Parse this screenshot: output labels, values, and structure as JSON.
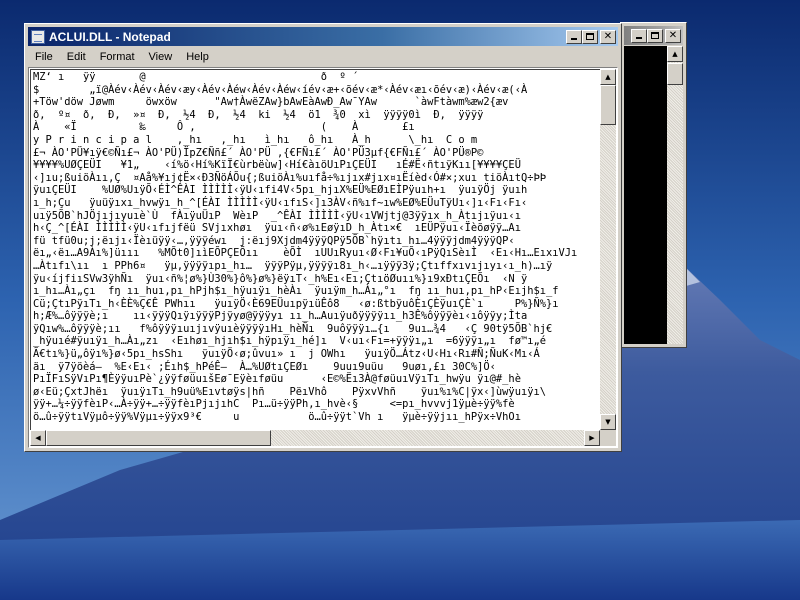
{
  "colors": {
    "active_title_start": "#0a246a",
    "active_title_end": "#a6caf0",
    "inactive_title": "#808080",
    "chrome": "#d4d0c8",
    "editor_bg": "#ffffff",
    "background_window_client": "#000000"
  },
  "background_window": {
    "title": "",
    "buttons": {
      "minimize_icon": "minimize-icon",
      "maximize_icon": "maximize-icon",
      "close_glyph": "✕"
    }
  },
  "notepad": {
    "title": "ACLUI.DLL - Notepad",
    "icon": "notepad-icon",
    "buttons": {
      "minimize_icon": "minimize-icon",
      "maximize_icon": "maximize-icon",
      "close_glyph": "✕"
    },
    "menu": [
      {
        "label": "File"
      },
      {
        "label": "Edit"
      },
      {
        "label": "Format"
      },
      {
        "label": "View"
      },
      {
        "label": "Help"
      }
    ],
    "lines": [
      "MZ‘ ı   ÿÿ       @                            ð  º ´ ",
      "$        „ï@Àév‹Àév‹Àév‹æy‹Àév‹Àéw‹Àév‹Àéw‹íév‹æ+‹õév‹æ*‹Àév‹æı‹õév‹æ)‹Àév‹æ(‹À",
      "+Töw'döw Jøwm     öwxöw      \"Aw†ÀwëZAw}bAwEàAwÐ_Aw¯YAw      `àwFtàwm%æw2{æv",
      "ð‚  º¤  ð‚  Ð‚  »¤  Ð‚  ½4  Ð‚  ½4  ki  ½4  ö1  ¾0  xì  ÿÿÿÿ0ì  Ð‚  ÿÿÿÿ",
      "À    «Ï          ‰     Ô ‚                    (    À       £ı",
      "y P r i n c i p a l    ‚_hı   ‚_hı   ì_hı   ô_hı   À_h      \\_hı  C o m",
      "£¬ ÀO'PÜ¥ıÿ€©Ñı£¬ ÀO'PÜ)ÏpZ€Ññ£´ ÀO'PÜ ‚{€FÑı£´ ÀO'PÜ3µf{€FÑı£´ ÀO'PÜ®P©",
      "¥¥¥¥%UØÇEÜI   ¥1„    ‹í%ö‹Hí%KïÏ€ùrbëùw]‹Hí€àıöUıPıÇEÜI   ıÉ#Ë‹ñtıÿKıı[¥¥¥¥ÇEÜ",
      "‹]ıu;ßuiöÀıı,Ç  ¤Aå%¥ıj¢Ë×‹Ð3ÑöÁÕu{;ßuiöÀı%uıfå÷%ıjıx#jıx¤ıËíèd‹Ó#×;xuı tiöÀıtQ÷ÞÞ",
      "ÿuıÇEÜI    %UØ%UıÿÕ‹ÉÌ^ÊÀI ÌÌÌÌÌ‹ÿU‹ıfi4V‹5pı_hjıX%EÜ%EØıEÌPÿuıh+ı  ÿuıÿÖj ÿuıh",
      "ı_h;Çu   ÿuüÿıxı_hvwÿı_h_^[ÉÀI ÌÌÌÌÌ‹ÿU‹ıfıS‹]ı3ÀV‹ñ%ıf~ıw%EØ%EÜuTÿUı‹]ı‹Fı‹Fı‹",
      "uıÿ5ÕB`hJÖjıjıyuıè`Ù  fÀıÿuÜıP  WèıP  _^ÊÀI ÌÌÌÌÌ‹ÿU‹ıVWjtj@3ÿÿıx_h_Àtıjıÿuı‹ı",
      "h‹Ç_^[ÉÀI ÌÌÌÌÌ‹ÿU‹ıfıjfëü SVjıxhøı  ÿuı‹ñ‹ø%ıEøÿıD_h_Àtı×€  ıEÜPÿuı‹Ïèõøÿÿ…Aı",
      "fü tfü0u;j;ëıjı‹Ïèıüÿÿ‹…,ÿÿÿéwı  j:ëıj9Xjdm4ÿÿÿQPÿ5ÕB`hÿıtı_hı…4ÿÿÿjdm4ÿÿÿQP‹",
      "ëı„‹ëı…A9Àı%]üııı   %MÕt0]ıìEÕPÇEÕıı    èÕÌ  ıUUıRyuı‹Ø‹Fı¥uÕ‹ıPÿQıSèıÌ  ‹Eı‹Hı…EıxıVJı",
      "…Àtıfı\\ıı  ı PPh6¤   ÿµ,ÿÿÿÿıpı_hı…  ÿÿÿPÿµ,ÿÿÿÿı8ı_h‹…ıÿÿÿ3ÿ;Çtıffxıvıjıyı‹ı_h)…ıÿ",
      "ÿu‹íjfiıSVw3ÿhÑı  ÿuı‹ñ%¦ø%}Ù30%}ô%}ø%}ëÿıT‹_h%Eı‹Eı;ÇtıöØuıı%}ı9xÐtıÇEÕı  ‹N ÿ",
      "ı_hı…Àı„çı  fŋ ıı_huı‚pı_hPjh$ı_hÿuıÿı_hèÀı  ÿuıÿm_h…Àı„°ı  fŋ ıı_huı‚pı_hP‹Eıjh$ı_f",
      "Cü;ÇtıPÿıTı_h‹ÈÈ%Ç€Ê PWhıı   ÿuıÿÖ‹È69EÜuıpÿıüÊô8   ‹ø:ßtbÿuôÈıÇÈÿuıÇÈ`ı     P%}Ñ%}ı",
      "h;Æ%…ôÿÿÿè;ı    ıı‹ÿÿÿQıÿıÿÿÿPjÿyø@ÿÿÿyı ıı_h…Auıÿuðÿÿÿÿıı_h3Ê%ôÿÿÿèı‹ıôÿÿy;Ìta",
      "ÿQıw%…ôÿÿÿè;ıı   f%ôÿÿÿıuıjıvÿuıèÿÿÿÿıHı_hèÑı  9uôÿÿÿı…{ı   9uı…¾4   ‹Ç 90tÿ5ÕB`hj€",
      "_hÿuıé#ÿuıÿı_h…Àı„zı  ‹Eıhøı_hjıh$ı_hÿpıÿı_hé]ı  V‹uı‹Fı=+ÿÿÿı„ı  =6ÿÿÿı„ı  fø™ı„é",
      "Ã€tı%}ü„ôÿı%}ø‹5pı_hsShı   ÿuıÿÖ‹ø;ûvuı» ı  j OWhı   ÿuıÿÖ…Átz‹U‹Hı‹Rı#Ñ;ÑuK‹Mı‹Á",
      "äı  ÿ7ÿöèá–  %E‹Eı‹ ;Éıh$_hPéÊ–  À…%UØtıÇEØı    9uuı9uüu   9uøı,£ı 30C%]Ö‹",
      "PıÏFıSÿVıPı¶ÈÿÿuıPè`¿ÿÿføüuıšEø¯Eÿèıføüu      ‹E©%Ëı3À@føüuıVÿıTı_hwÿu ÿı@#_hè",
      "ø‹Eü;ÇxtJhëı  ÿuıÿıTı_h9uü%Eıvtøÿs|hñ    PëıVhô    PÿxvVhñ    ÿuı%ı%C|ÿx‹]ùwÿuıÿı\\",
      "ÿÿ+…¼÷ÿÿfèıP‹…À÷ÿÿ+…÷ÿÿfèıPjıjıhC  Pı…ü÷ÿÿPh‚ı_hvè‹§     <=pı_hvvvj1ÿµè÷ÿÿ%fè",
      "ö…û÷ÿÿtıVÿµô÷ÿÿ%Vÿµı÷ÿÿx9³€     u           ö…û÷ÿÿt`Vh ı   ÿµè÷ÿÿjıı_hPÿx÷VhOı"
    ]
  }
}
